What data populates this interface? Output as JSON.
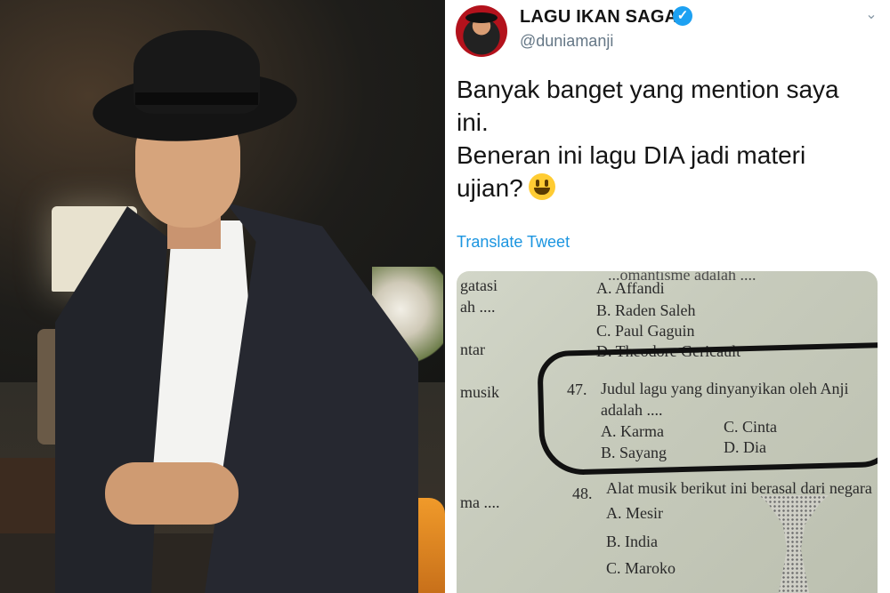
{
  "tweet": {
    "display_name": "LAGU IKAN SAGA -",
    "verified_glyph": "✓",
    "handle": "@duniamanji",
    "caret_icon": "chevron-down-icon",
    "text_lines": [
      "Banyak banget yang mention saya",
      "ini.",
      "Beneran ini lagu DIA jadi materi",
      "ujian?"
    ],
    "emoji": "smiley-emoji",
    "translate_label": "Translate Tweet",
    "link_color": "#1b95e0",
    "verified_color": "#1da1f2"
  },
  "exam": {
    "top_partial": "...omantisme adalah ....",
    "left_margin": [
      "gatasi",
      "ah ....",
      "ntar",
      "musik",
      "ma ...."
    ],
    "q46_options": [
      "A. Affandi",
      "B. Raden Saleh",
      "C. Paul Gaguin",
      "D. Theodore Gericault"
    ],
    "q47": {
      "number": "47.",
      "text1": "Judul lagu yang dinyanyikan oleh Anji",
      "text2": "adalah ....",
      "opt_a": "A. Karma",
      "opt_b": "B. Sayang",
      "opt_c": "C. Cinta",
      "opt_d": "D. Dia"
    },
    "q48": {
      "number": "48.",
      "text": "Alat musik berikut ini berasal dari negara",
      "opt_a": "A. Mesir",
      "opt_b": "B. India",
      "opt_c": "C. Maroko"
    }
  }
}
